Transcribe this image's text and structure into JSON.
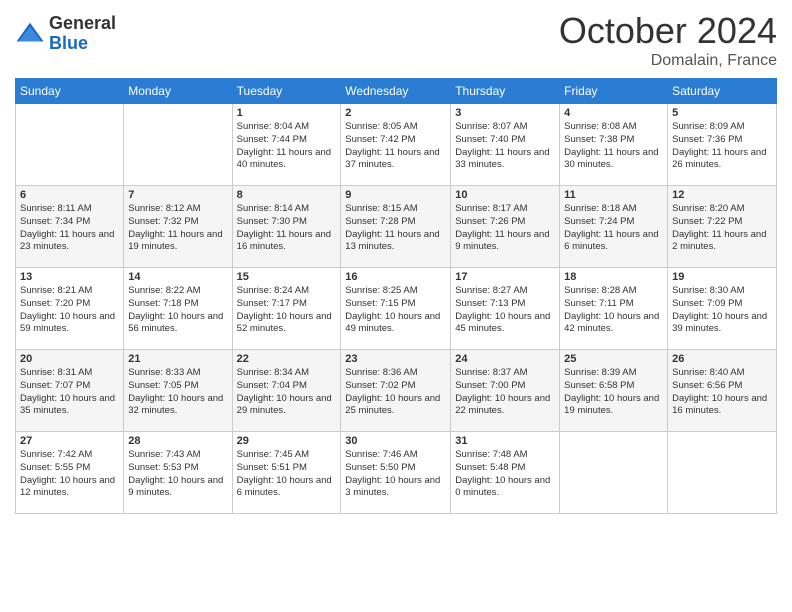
{
  "header": {
    "logo_general": "General",
    "logo_blue": "Blue",
    "month": "October 2024",
    "location": "Domalain, France"
  },
  "days_of_week": [
    "Sunday",
    "Monday",
    "Tuesday",
    "Wednesday",
    "Thursday",
    "Friday",
    "Saturday"
  ],
  "weeks": [
    [
      {
        "day": "",
        "info": ""
      },
      {
        "day": "",
        "info": ""
      },
      {
        "day": "1",
        "info": "Sunrise: 8:04 AM\nSunset: 7:44 PM\nDaylight: 11 hours and 40 minutes."
      },
      {
        "day": "2",
        "info": "Sunrise: 8:05 AM\nSunset: 7:42 PM\nDaylight: 11 hours and 37 minutes."
      },
      {
        "day": "3",
        "info": "Sunrise: 8:07 AM\nSunset: 7:40 PM\nDaylight: 11 hours and 33 minutes."
      },
      {
        "day": "4",
        "info": "Sunrise: 8:08 AM\nSunset: 7:38 PM\nDaylight: 11 hours and 30 minutes."
      },
      {
        "day": "5",
        "info": "Sunrise: 8:09 AM\nSunset: 7:36 PM\nDaylight: 11 hours and 26 minutes."
      }
    ],
    [
      {
        "day": "6",
        "info": "Sunrise: 8:11 AM\nSunset: 7:34 PM\nDaylight: 11 hours and 23 minutes."
      },
      {
        "day": "7",
        "info": "Sunrise: 8:12 AM\nSunset: 7:32 PM\nDaylight: 11 hours and 19 minutes."
      },
      {
        "day": "8",
        "info": "Sunrise: 8:14 AM\nSunset: 7:30 PM\nDaylight: 11 hours and 16 minutes."
      },
      {
        "day": "9",
        "info": "Sunrise: 8:15 AM\nSunset: 7:28 PM\nDaylight: 11 hours and 13 minutes."
      },
      {
        "day": "10",
        "info": "Sunrise: 8:17 AM\nSunset: 7:26 PM\nDaylight: 11 hours and 9 minutes."
      },
      {
        "day": "11",
        "info": "Sunrise: 8:18 AM\nSunset: 7:24 PM\nDaylight: 11 hours and 6 minutes."
      },
      {
        "day": "12",
        "info": "Sunrise: 8:20 AM\nSunset: 7:22 PM\nDaylight: 11 hours and 2 minutes."
      }
    ],
    [
      {
        "day": "13",
        "info": "Sunrise: 8:21 AM\nSunset: 7:20 PM\nDaylight: 10 hours and 59 minutes."
      },
      {
        "day": "14",
        "info": "Sunrise: 8:22 AM\nSunset: 7:18 PM\nDaylight: 10 hours and 56 minutes."
      },
      {
        "day": "15",
        "info": "Sunrise: 8:24 AM\nSunset: 7:17 PM\nDaylight: 10 hours and 52 minutes."
      },
      {
        "day": "16",
        "info": "Sunrise: 8:25 AM\nSunset: 7:15 PM\nDaylight: 10 hours and 49 minutes."
      },
      {
        "day": "17",
        "info": "Sunrise: 8:27 AM\nSunset: 7:13 PM\nDaylight: 10 hours and 45 minutes."
      },
      {
        "day": "18",
        "info": "Sunrise: 8:28 AM\nSunset: 7:11 PM\nDaylight: 10 hours and 42 minutes."
      },
      {
        "day": "19",
        "info": "Sunrise: 8:30 AM\nSunset: 7:09 PM\nDaylight: 10 hours and 39 minutes."
      }
    ],
    [
      {
        "day": "20",
        "info": "Sunrise: 8:31 AM\nSunset: 7:07 PM\nDaylight: 10 hours and 35 minutes."
      },
      {
        "day": "21",
        "info": "Sunrise: 8:33 AM\nSunset: 7:05 PM\nDaylight: 10 hours and 32 minutes."
      },
      {
        "day": "22",
        "info": "Sunrise: 8:34 AM\nSunset: 7:04 PM\nDaylight: 10 hours and 29 minutes."
      },
      {
        "day": "23",
        "info": "Sunrise: 8:36 AM\nSunset: 7:02 PM\nDaylight: 10 hours and 25 minutes."
      },
      {
        "day": "24",
        "info": "Sunrise: 8:37 AM\nSunset: 7:00 PM\nDaylight: 10 hours and 22 minutes."
      },
      {
        "day": "25",
        "info": "Sunrise: 8:39 AM\nSunset: 6:58 PM\nDaylight: 10 hours and 19 minutes."
      },
      {
        "day": "26",
        "info": "Sunrise: 8:40 AM\nSunset: 6:56 PM\nDaylight: 10 hours and 16 minutes."
      }
    ],
    [
      {
        "day": "27",
        "info": "Sunrise: 7:42 AM\nSunset: 5:55 PM\nDaylight: 10 hours and 12 minutes."
      },
      {
        "day": "28",
        "info": "Sunrise: 7:43 AM\nSunset: 5:53 PM\nDaylight: 10 hours and 9 minutes."
      },
      {
        "day": "29",
        "info": "Sunrise: 7:45 AM\nSunset: 5:51 PM\nDaylight: 10 hours and 6 minutes."
      },
      {
        "day": "30",
        "info": "Sunrise: 7:46 AM\nSunset: 5:50 PM\nDaylight: 10 hours and 3 minutes."
      },
      {
        "day": "31",
        "info": "Sunrise: 7:48 AM\nSunset: 5:48 PM\nDaylight: 10 hours and 0 minutes."
      },
      {
        "day": "",
        "info": ""
      },
      {
        "day": "",
        "info": ""
      }
    ]
  ]
}
